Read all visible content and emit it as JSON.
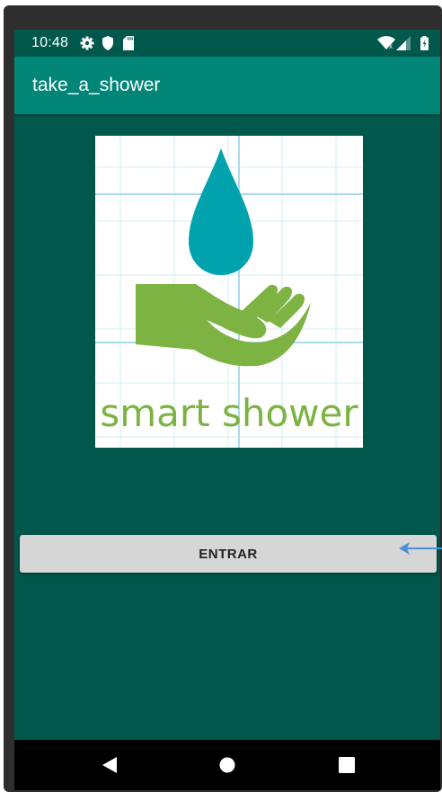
{
  "status_bar": {
    "time": "10:48",
    "left_icons": [
      "gear-icon",
      "shield-icon",
      "sd-card-icon"
    ],
    "right_icons": [
      "wifi-icon",
      "signal-icon",
      "battery-icon"
    ]
  },
  "app_bar": {
    "title": "take_a_shower"
  },
  "logo": {
    "text": "smart shower",
    "text_color": "#7cb342",
    "drop_color": "#00a3ad"
  },
  "main": {
    "enter_label": "ENTRAR"
  },
  "nav_bar": {
    "buttons": [
      "back-icon",
      "home-icon",
      "recents-icon"
    ]
  },
  "colors": {
    "background": "#00574b",
    "app_bar": "#008577",
    "button": "#d6d6d6",
    "annotation_arrow": "#4a90d9"
  }
}
